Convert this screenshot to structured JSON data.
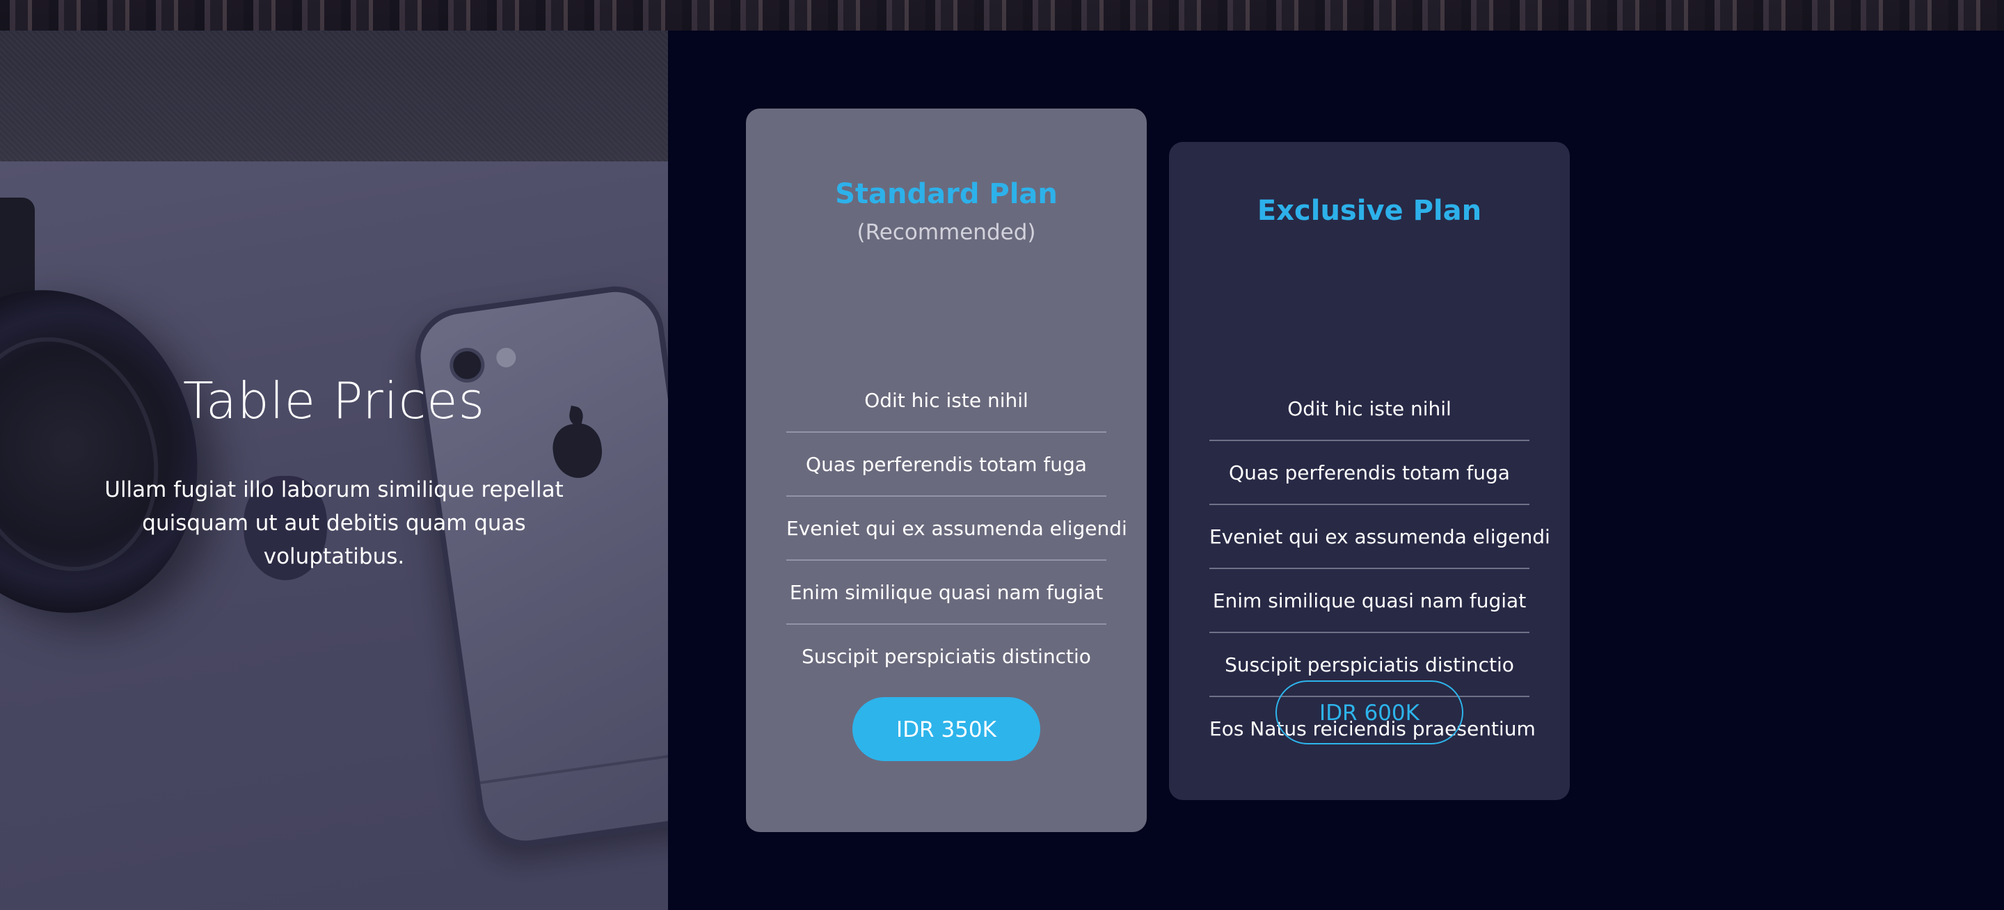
{
  "hero": {
    "title": "Table Prices",
    "description": "Ullam fugiat illo laborum similique repellat quisquam ut aut debitis quam quas voluptatibus."
  },
  "plans": [
    {
      "name": "Standard Plan",
      "subtitle": "(Recommended)",
      "features": [
        "Odit hic iste nihil",
        "Quas perferendis totam fuga",
        "Eveniet qui ex assumenda eligendi",
        "Enim similique quasi nam fugiat",
        "Suscipit perspiciatis distinctio"
      ],
      "price_label": "IDR 350K"
    },
    {
      "name": "Exclusive Plan",
      "features": [
        "Odit hic iste nihil",
        "Quas perferendis totam fuga",
        "Eveniet qui ex assumenda eligendi",
        "Enim similique quasi nam fugiat",
        "Suscipit perspiciatis distinctio",
        "Eos Natus reiciendis praesentium"
      ],
      "price_label": "IDR 600K"
    }
  ],
  "colors": {
    "accent": "#2db4eb",
    "background": "#03041d",
    "standard_card": "#6a6a7e",
    "exclusive_card": "#282945"
  }
}
